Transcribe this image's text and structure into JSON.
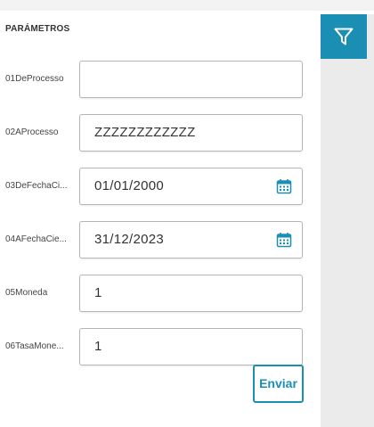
{
  "section_title": "PARÁMETROS",
  "params": [
    {
      "label": "01DeProcesso",
      "value": "",
      "has_calendar": false
    },
    {
      "label": "02AProcesso",
      "value": "ZZZZZZZZZZZZ",
      "has_calendar": false
    },
    {
      "label": "03DeFechaCi...",
      "value": "01/01/2000",
      "has_calendar": true
    },
    {
      "label": "04AFechaCie...",
      "value": "31/12/2023",
      "has_calendar": true
    },
    {
      "label": "05Moneda",
      "value": "1",
      "has_calendar": false
    },
    {
      "label": "06TasaMone...",
      "value": "1",
      "has_calendar": false
    }
  ],
  "submit_label": "Enviar",
  "icons": {
    "filter": "filter-icon",
    "calendar": "calendar-icon"
  },
  "colors": {
    "accent": "#1b8fb3",
    "sidebar": "#ebebeb"
  }
}
